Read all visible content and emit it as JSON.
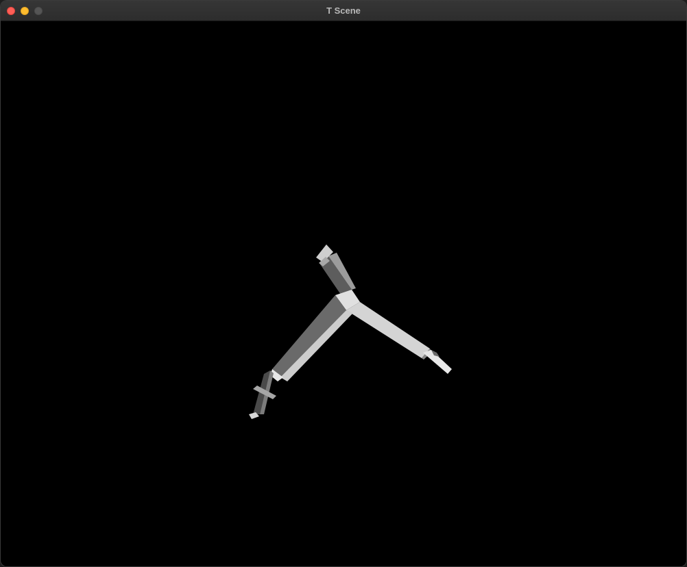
{
  "window": {
    "title": "T Scene"
  },
  "titlebar_buttons": {
    "close": "close-icon",
    "minimize": "minimize-icon",
    "zoom": "zoom-icon"
  },
  "scene": {
    "background_color": "#000000",
    "model_color": "#d8d8d8",
    "shade_dark": "#5a5a5a",
    "shade_mid": "#9a9a9a"
  }
}
